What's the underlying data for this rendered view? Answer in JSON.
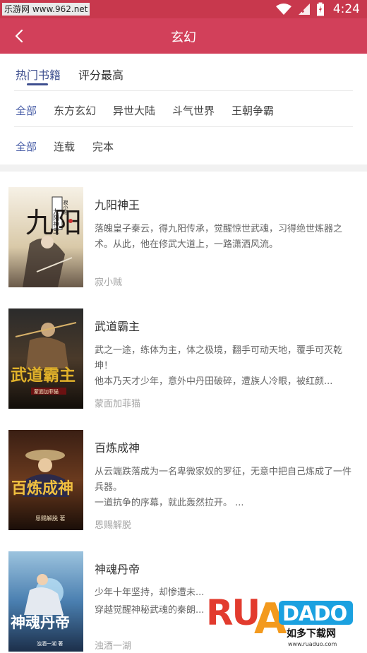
{
  "status_bar": {
    "watermark": "乐游网 www.962.net",
    "time": "4:24"
  },
  "app_bar": {
    "title": "玄幻"
  },
  "tabs": [
    {
      "label": "热门书籍"
    },
    {
      "label": "评分最高"
    }
  ],
  "category_filters": [
    "全部",
    "东方玄幻",
    "异世大陆",
    "斗气世界",
    "王朝争霸"
  ],
  "status_filters": [
    "全部",
    "连载",
    "完本"
  ],
  "books": [
    {
      "title": "九阳神王",
      "description": "落魄皇子秦云，得九阳传承，觉醒惊世武魂，习得绝世炼器之术。从此，他在修武大道上，一路潇洒风流。",
      "author": "寂小贼",
      "cover_text": "九阳",
      "cover_subtitle": "九阳神王",
      "cover_author": "寂小贼"
    },
    {
      "title": "武道霸主",
      "description": "武之一途，练体为主，体之极境，翻手可动天地，覆手可灭乾坤！\n他本乃天才少年，意外中丹田破碎，遭族人冷眼，被红颜...",
      "author": "蒙面加菲猫",
      "cover_text": "武道霸主",
      "cover_author": "蒙面加菲猫"
    },
    {
      "title": "百炼成神",
      "description": "从云端跌落成为一名卑微家奴的罗征，无意中把自己炼成了一件兵器。\n一道抗争的序幕，就此轰然拉开。 ...",
      "author": "恩赐解脱",
      "cover_text": "百炼成神",
      "cover_author": "恩赐解脱 著"
    },
    {
      "title": "神魂丹帝",
      "description": "少年十年坚持，却惨遭未...\n穿越觉醒神秘武魂的秦朗...",
      "author": "浊酒一湖",
      "cover_text": "神魂丹帝",
      "cover_author": "浊酒一湖 著"
    }
  ],
  "brand_watermark": {
    "logo": "RUANDADO",
    "name": "如多下载网",
    "url": "www.ruaduo.com"
  },
  "colors": {
    "status_bar": "#c8384d",
    "app_bar": "#d2405a",
    "accent": "#3e4f8f"
  }
}
